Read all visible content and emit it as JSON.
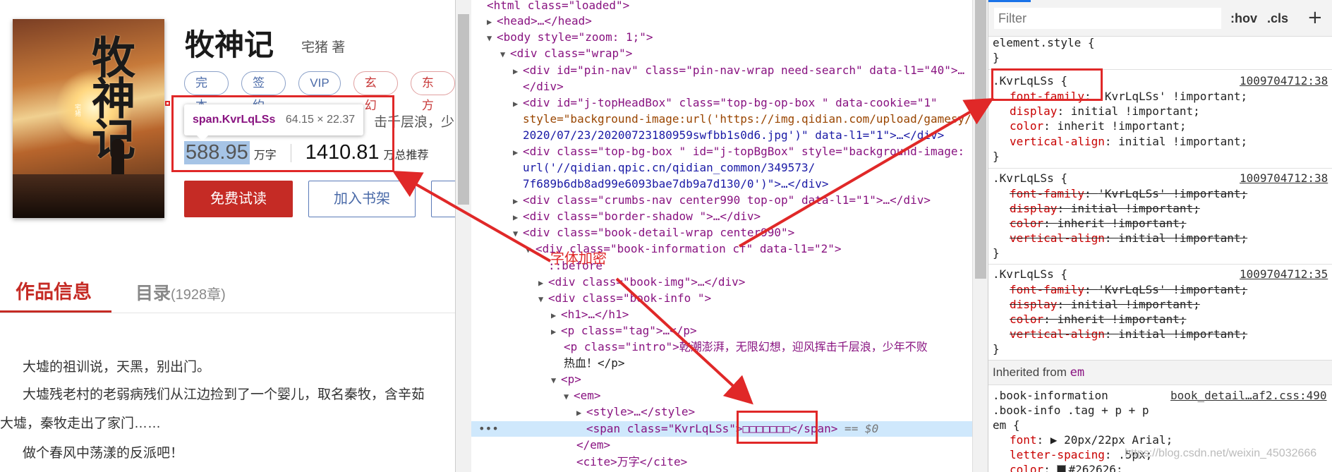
{
  "book": {
    "cover_title": "牧神记",
    "cover_author": "宅猪",
    "title": "牧神记",
    "author": "宅猪 著",
    "tags": [
      "完本",
      "签约",
      "VIP",
      "玄幻",
      "东方"
    ],
    "intro_fragment": "击千层浪，少",
    "words_value": "588.95",
    "words_unit": "万字",
    "recommend_value": "1410.81",
    "recommend_unit": "万总推荐",
    "btn_read": "免费试读",
    "btn_shelf": "加入书架",
    "tab_info": "作品信息",
    "tab_catalog": "目录",
    "tab_catalog_count": "(1928章)",
    "paragraphs": [
      "大墟的祖训说，天黑，别出门。",
      "大墟残老村的老弱病残们从江边捡到了一个婴儿，取名秦牧，含辛茹",
      "大墟，秦牧走出了家门……",
      "做个春风中荡漾的反派吧！"
    ]
  },
  "tooltip": {
    "selector": "span.KvrLqLSs",
    "size": "64.15 × 22.37"
  },
  "elements_panel": {
    "ellipsis": "…",
    "equals_dollar": " == $0",
    "lines": {
      "l0": [
        "<html class=\"loaded\">"
      ],
      "l1": [
        "<head>…</head>"
      ],
      "l2": [
        "<body style=\"zoom: 1;\">"
      ],
      "l3": [
        "<div class=\"wrap\">"
      ],
      "l4": [
        "<div id=\"pin-nav\" class=\"pin-nav-wrap need-search\" data-l1=\"40\">…"
      ],
      "l5": [
        "</div>"
      ],
      "l6": [
        "<div id=\"j-topHeadBox\" class=\"top-bg-op-box \" data-cookie=\"1\""
      ],
      "l7": [
        "style=\"background-image:url('https://img.qidian.com/upload/gamesy/"
      ],
      "l8": [
        "2020/07/23/20200723180959swfbb1s0d6.jpg')\" data-l1=\"1\">…</div>"
      ],
      "l9": [
        "<div class=\"top-bg-box \" id=\"j-topBgBox\" style=\"background-image:"
      ],
      "l10": [
        "url('//qidian.qpic.cn/qidian_common/349573/"
      ],
      "l11": [
        "7f689b6db8ad99e6093bae7db9a7d130/0')\">…</div>"
      ],
      "l12": [
        "<div class=\"crumbs-nav center990  top-op\" data-l1=\"1\">…</div>"
      ],
      "l13": [
        "<div class=\"border-shadow \">…</div>"
      ],
      "l14": [
        "<div class=\"book-detail-wrap center990\">"
      ],
      "l15": [
        "<div class=\"book-information cf\" data-l1=\"2\">"
      ],
      "l16": [
        "::before"
      ],
      "l17": [
        "<div class=\"book-img\">…</div>"
      ],
      "l18": [
        "<div class=\"book-info \">"
      ],
      "l19": [
        "<h1>…</h1>"
      ],
      "l20": [
        "<p class=\"tag\">…</p>"
      ],
      "l21": [
        "<p class=\"intro\">乾潮澎湃，无限幻想，迎风挥击千层浪，少年不败"
      ],
      "l22": [
        "热血！</p>"
      ],
      "l23": [
        "<p>"
      ],
      "l24": [
        "<em>"
      ],
      "l25": [
        "<style>…</style>"
      ],
      "l26": [
        "<span class=\"KvrLqLSs\">□□□□□□□</span>"
      ],
      "l27": [
        "</em>"
      ],
      "l28": [
        "<cite>万字</cite>"
      ]
    }
  },
  "styles_panel": {
    "filter_placeholder": "Filter",
    "hov": ":hov",
    "cls": ".cls",
    "add": "+",
    "element_style": "element.style {",
    "close_brace": "}",
    "rule_selector": ".KvrLqLSs {",
    "src1": "1009704712:38",
    "src2": "1009704712:38",
    "src3": "1009704712:35",
    "decl_font_family_prop": "font-family",
    "decl_font_family_val": "'KvrLqLSs' !important;",
    "decl_display_prop": "display",
    "decl_display_val": "initial !important;",
    "decl_color_prop": "color",
    "decl_color_val": "inherit !important;",
    "decl_va_prop": "vertical-align",
    "decl_va_val": "initial !important;",
    "inherited_label": "Inherited from",
    "inherited_tag": "em",
    "inh_sel1": ".book-information",
    "inh_src": "book_detail…af2.css:490",
    "inh_sel2": ".book-info .tag + p + p",
    "inh_sel3": "em {",
    "inh_font_prop": "font",
    "inh_font_val": "20px/22px Arial;",
    "inh_ls_prop": "letter-spacing",
    "inh_ls_val": ".5px;",
    "inh_color_prop": "color",
    "inh_color_val": "#262626;"
  },
  "annotation": {
    "label": "字体加密"
  },
  "watermark": "https://blog.csdn.net/weixin_45032666",
  "colors": {
    "accent_red": "#c52b25",
    "annotation_red": "#e02828",
    "selection_blue": "#cfe8fc",
    "tag_purple": "#881280"
  }
}
